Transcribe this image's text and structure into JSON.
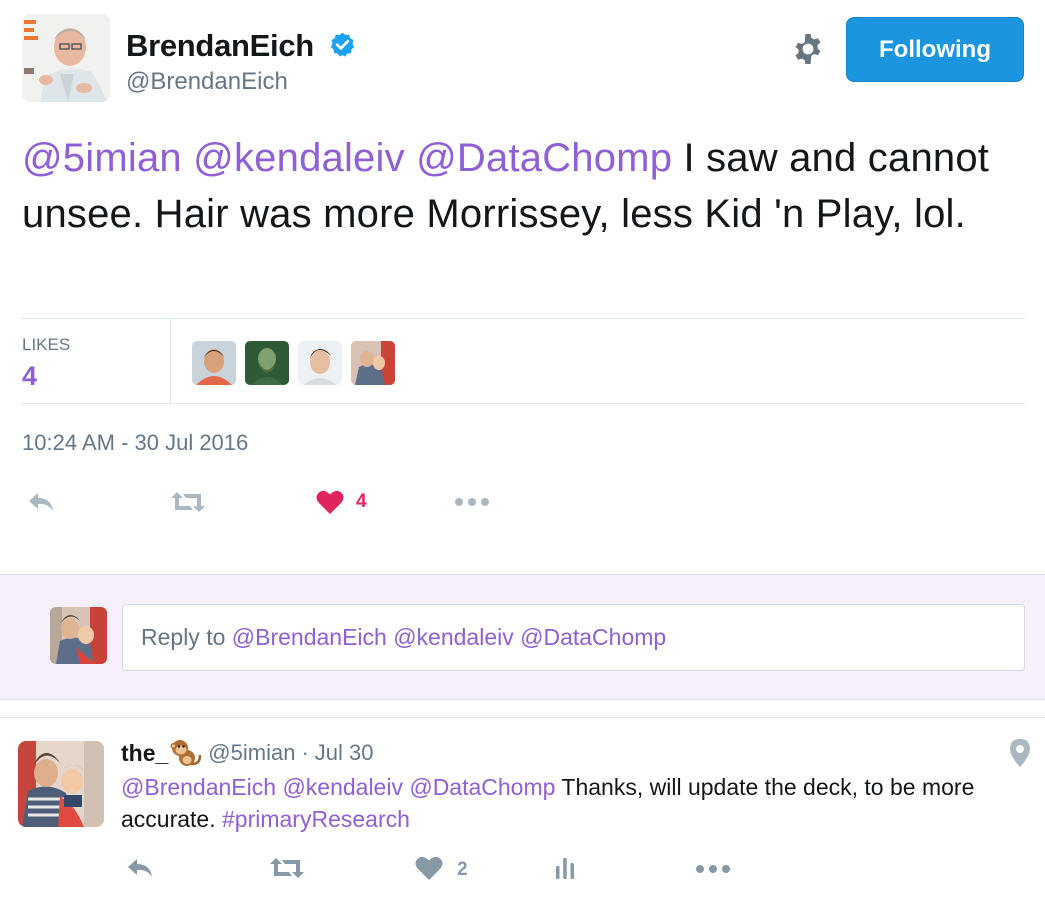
{
  "author": {
    "name": "BrendanEich",
    "handle": "@BrendanEich",
    "verified": true
  },
  "follow_button": {
    "label": "Following"
  },
  "tweet": {
    "mentions": [
      "@5imian",
      "@kendaleiv",
      "@DataChomp"
    ],
    "text": " I saw and cannot unsee. Hair was more Morrissey, less Kid 'n Play, lol.",
    "timestamp": "10:24 AM - 30 Jul 2016"
  },
  "stats": {
    "likes_label": "LIKES",
    "likes_count": "4",
    "liker_avatar_count": 4
  },
  "actions": {
    "like_count": "4",
    "icons": [
      "reply-icon",
      "retweet-icon",
      "heart-icon",
      "more-icon"
    ]
  },
  "reply_box": {
    "prefix": "Reply to ",
    "mentions": "@BrendanEich @kendaleiv @DataChomp"
  },
  "reply_tweet": {
    "name": "the_",
    "emoji": "monkey",
    "handle": "@5imian",
    "separator": "·",
    "date": "Jul 30",
    "mentions": "@BrendanEich @kendaleiv @DataChomp",
    "text": " Thanks, will update the deck, to be more accurate. ",
    "hashtag": "#primaryResearch",
    "like_count": "2"
  },
  "colors": {
    "link": "#8f5fd5",
    "follow_button": "#1b95e0",
    "heart_active": "#e0245e",
    "reply_area_bg": "#f5f0fb",
    "muted_text": "#657786"
  }
}
